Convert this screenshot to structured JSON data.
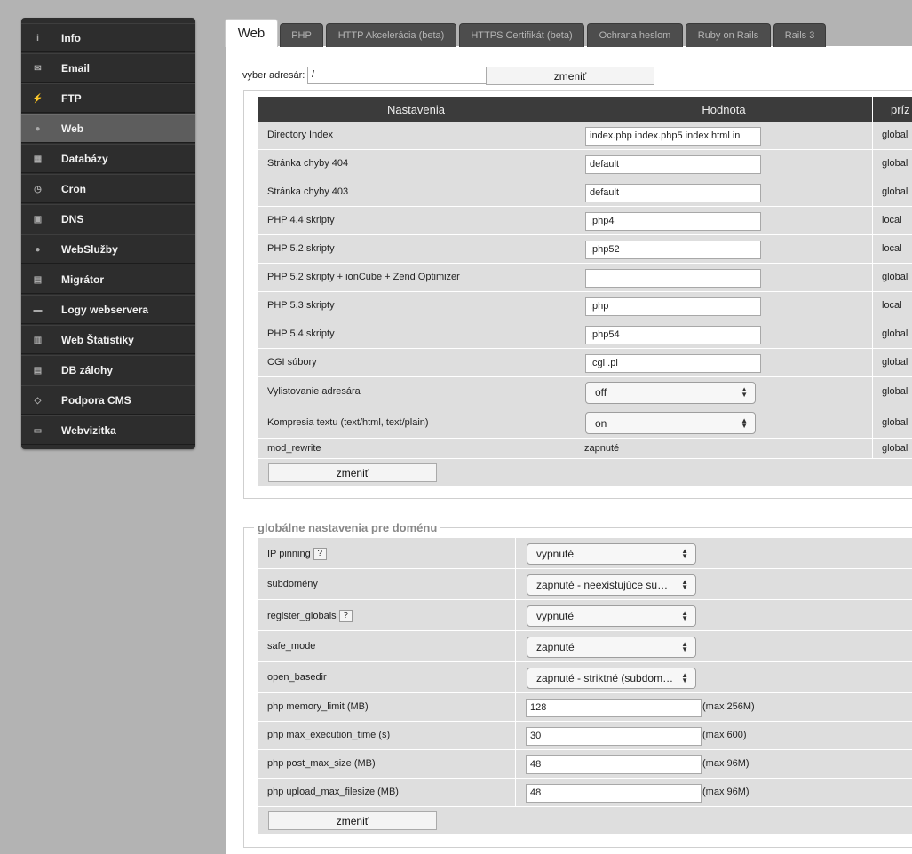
{
  "sidebar": {
    "items": [
      {
        "label": "Info",
        "icon": "info-icon",
        "glyph": "i"
      },
      {
        "label": "Email",
        "icon": "email-icon",
        "glyph": "✉"
      },
      {
        "label": "FTP",
        "icon": "ftp-icon",
        "glyph": "⚡"
      },
      {
        "label": "Web",
        "icon": "web-icon",
        "glyph": "●",
        "active": true
      },
      {
        "label": "Databázy",
        "icon": "database-icon",
        "glyph": "▦"
      },
      {
        "label": "Cron",
        "icon": "clock-icon",
        "glyph": "◷"
      },
      {
        "label": "DNS",
        "icon": "dns-icon",
        "glyph": "▣"
      },
      {
        "label": "WebSlužby",
        "icon": "webservices-icon",
        "glyph": "●"
      },
      {
        "label": "Migrátor",
        "icon": "migrator-icon",
        "glyph": "▤"
      },
      {
        "label": "Logy webservera",
        "icon": "logs-icon",
        "glyph": "▬"
      },
      {
        "label": "Web Štatistiky",
        "icon": "stats-icon",
        "glyph": "▥"
      },
      {
        "label": "DB zálohy",
        "icon": "backup-icon",
        "glyph": "▤"
      },
      {
        "label": "Podpora CMS",
        "icon": "code-icon",
        "glyph": "◇"
      },
      {
        "label": "Webvizitka",
        "icon": "monitor-icon",
        "glyph": "▭"
      }
    ]
  },
  "tabs": [
    "Web",
    "PHP",
    "HTTP Akcelerácia (beta)",
    "HTTPS Certifikát (beta)",
    "Ochrana heslom",
    "Ruby on Rails",
    "Rails 3"
  ],
  "dir": {
    "label": "vyber adresár:",
    "value": "/",
    "button": "zmeniť"
  },
  "settings": {
    "headers": [
      "Nastavenia",
      "Hodnota",
      "príz"
    ],
    "rows": [
      {
        "label": "Directory Index",
        "kind": "input",
        "value": "index.php index.php5 index.html in",
        "scope": "global"
      },
      {
        "label": "Stránka chyby 404",
        "kind": "input",
        "value": "default",
        "scope": "global"
      },
      {
        "label": "Stránka chyby 403",
        "kind": "input",
        "value": "default",
        "scope": "global"
      },
      {
        "label": "PHP 4.4 skripty",
        "kind": "input",
        "value": ".php4",
        "scope": "local"
      },
      {
        "label": "PHP 5.2 skripty",
        "kind": "input",
        "value": ".php52",
        "scope": "local"
      },
      {
        "label": "PHP 5.2 skripty + ionCube + Zend Optimizer",
        "kind": "input",
        "value": "",
        "scope": "global"
      },
      {
        "label": "PHP 5.3 skripty",
        "kind": "input",
        "value": ".php",
        "scope": "local"
      },
      {
        "label": "PHP 5.4 skripty",
        "kind": "input",
        "value": ".php54",
        "scope": "global"
      },
      {
        "label": "CGI súbory",
        "kind": "input",
        "value": ".cgi .pl",
        "scope": "global"
      },
      {
        "label": "Vylistovanie adresára",
        "kind": "select",
        "value": "off",
        "scope": "global"
      },
      {
        "label": "Kompresia textu (text/html, text/plain)",
        "kind": "select",
        "value": "on",
        "scope": "global"
      },
      {
        "label": "mod_rewrite",
        "kind": "text",
        "value": "zapnuté",
        "scope": "global"
      }
    ],
    "submit": "zmeniť"
  },
  "global": {
    "legend": "globálne nastavenia pre doménu",
    "help": "?",
    "rows": [
      {
        "label": "IP pinning",
        "help": true,
        "kind": "select",
        "value": "vypnuté"
      },
      {
        "label": "subdomény",
        "kind": "select",
        "value": "zapnuté - neexistujúce su…"
      },
      {
        "label": "register_globals",
        "help": true,
        "kind": "select",
        "value": "vypnuté"
      },
      {
        "label": "safe_mode",
        "kind": "select",
        "value": "zapnuté"
      },
      {
        "label": "open_basedir",
        "kind": "select",
        "value": "zapnuté - striktné (subdom…"
      },
      {
        "label": "php memory_limit (MB)",
        "kind": "input",
        "value": "128",
        "note": "(max 256M)"
      },
      {
        "label": "php max_execution_time (s)",
        "kind": "input",
        "value": "30",
        "note": "(max 600)"
      },
      {
        "label": "php post_max_size (MB)",
        "kind": "input",
        "value": "48",
        "note": "(max 96M)"
      },
      {
        "label": "php upload_max_filesize (MB)",
        "kind": "input",
        "value": "48",
        "note": "(max 96M)"
      }
    ],
    "submit": "zmeniť"
  }
}
